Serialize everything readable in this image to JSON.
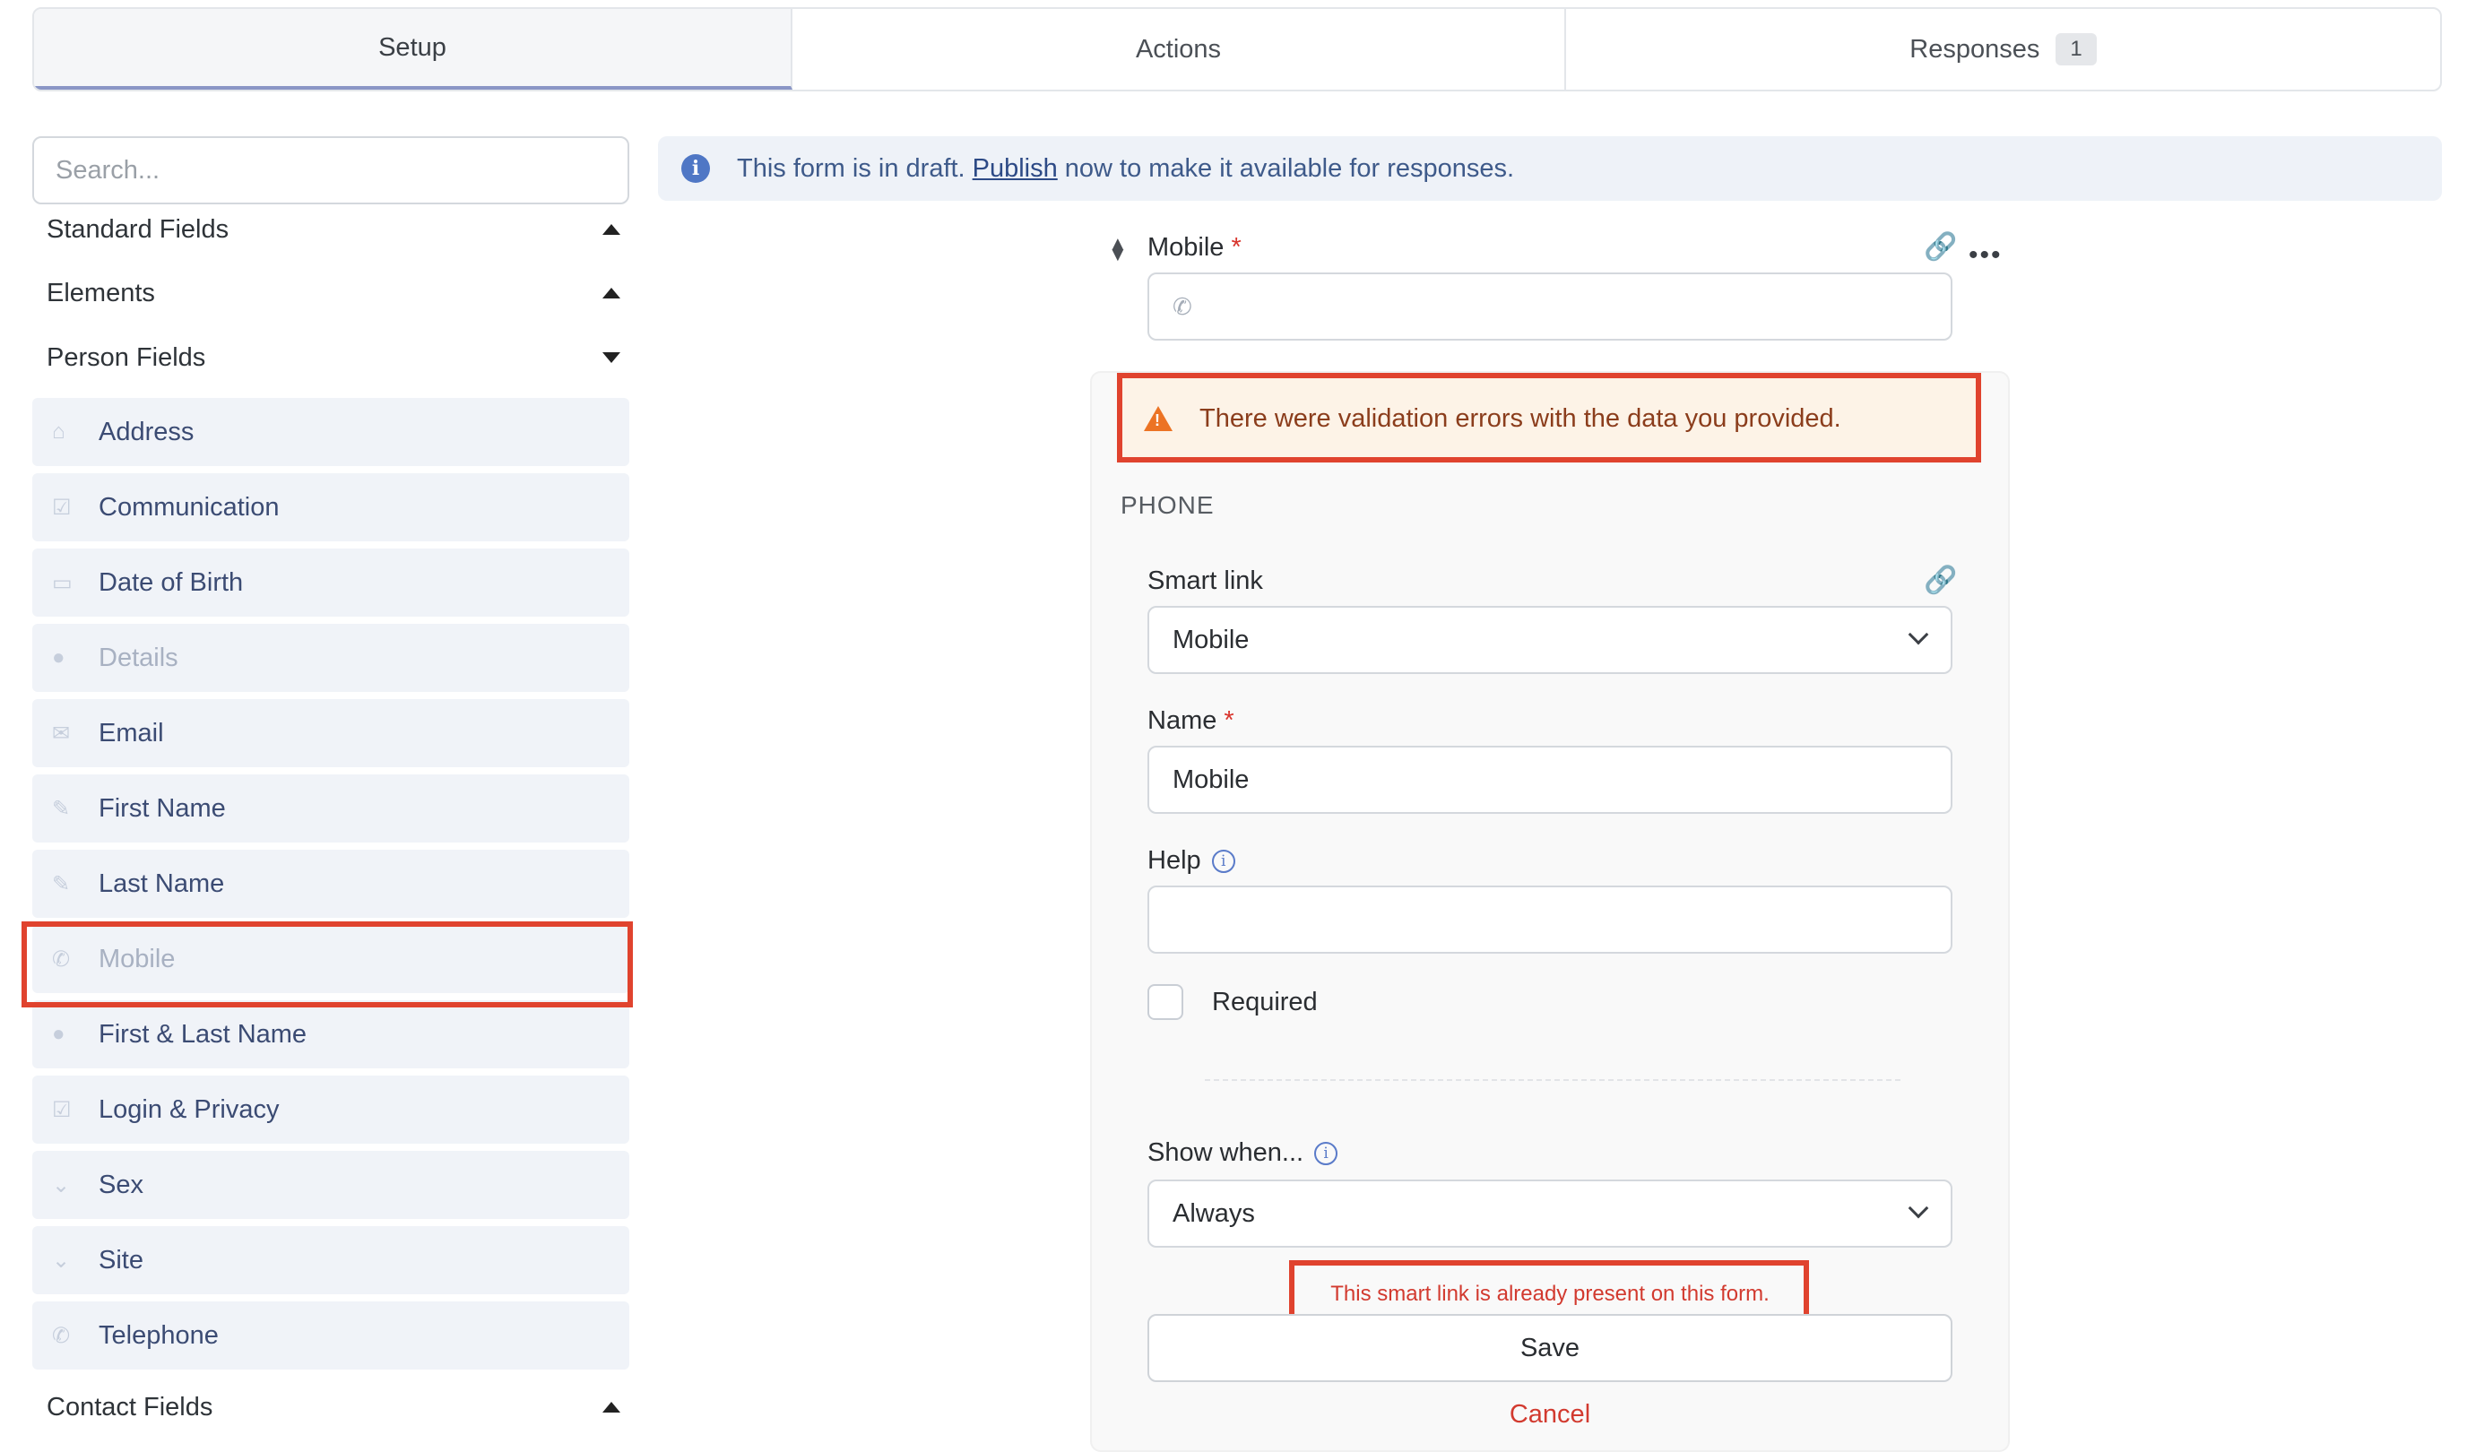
{
  "tabs": [
    {
      "label": "Setup"
    },
    {
      "label": "Actions"
    },
    {
      "label": "Responses",
      "badge": "1"
    }
  ],
  "sidebar": {
    "search_placeholder": "Search...",
    "sections": {
      "standard": "Standard Fields",
      "elements": "Elements",
      "person": "Person Fields",
      "contact": "Contact Fields"
    },
    "person_fields": [
      {
        "label": "Address",
        "icon": "home-icon"
      },
      {
        "label": "Communication",
        "icon": "checkbox-icon"
      },
      {
        "label": "Date of Birth",
        "icon": "calendar-icon"
      },
      {
        "label": "Details",
        "icon": "person-icon"
      },
      {
        "label": "Email",
        "icon": "envelope-icon"
      },
      {
        "label": "First Name",
        "icon": "pencil-icon"
      },
      {
        "label": "Last Name",
        "icon": "pencil-icon"
      },
      {
        "label": "Mobile",
        "icon": "phone-icon"
      },
      {
        "label": "First & Last Name",
        "icon": "person-icon"
      },
      {
        "label": "Login & Privacy",
        "icon": "checkbox-icon"
      },
      {
        "label": "Sex",
        "icon": "chevron-down-icon"
      },
      {
        "label": "Site",
        "icon": "chevron-down-icon"
      },
      {
        "label": "Telephone",
        "icon": "phone-icon"
      }
    ]
  },
  "banner": {
    "prefix": "This form is in draft.",
    "link": "Publish",
    "suffix": "now to make it available for responses."
  },
  "field": {
    "label": "Mobile",
    "required_mark": "*"
  },
  "panel": {
    "warning": "There were validation errors with the data you provided.",
    "section_title": "PHONE",
    "smart_link_label": "Smart link",
    "smart_link_value": "Mobile",
    "name_label": "Name",
    "name_value": "Mobile",
    "help_label": "Help",
    "help_value": "",
    "required_label": "Required",
    "show_when_label": "Show when...",
    "show_when_value": "Always",
    "error": "This smart link is already present on this form.",
    "save": "Save",
    "cancel": "Cancel"
  },
  "colors": {
    "highlight": "#e0432e",
    "accent": "#4f77c5",
    "error": "#d23a2f"
  }
}
